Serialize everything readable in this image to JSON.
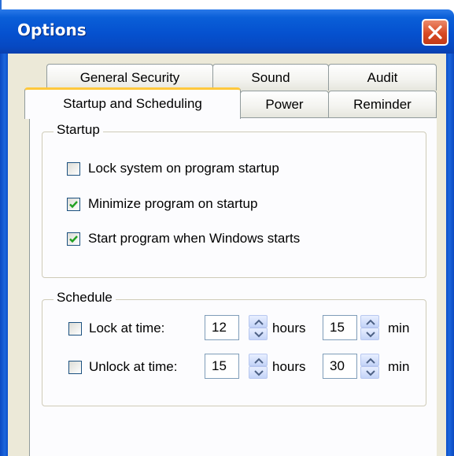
{
  "window": {
    "title": "Options"
  },
  "tabs": {
    "row1": [
      "General Security",
      "Sound",
      "Audit"
    ],
    "row2": [
      "Startup and Scheduling",
      "Power",
      "Reminder"
    ],
    "active": "Startup and Scheduling"
  },
  "startup": {
    "legend": "Startup",
    "options": [
      {
        "label": "Lock system on program startup",
        "checked": false
      },
      {
        "label": "Minimize program on startup",
        "checked": true
      },
      {
        "label": "Start program when Windows starts",
        "checked": true
      }
    ]
  },
  "schedule": {
    "legend": "Schedule",
    "lock": {
      "label": "Lock at time:",
      "checked": false,
      "hours": "12",
      "hours_unit": "hours",
      "minutes": "15",
      "minutes_unit": "min"
    },
    "unlock": {
      "label": "Unlock at time:",
      "checked": false,
      "hours": "15",
      "hours_unit": "hours",
      "minutes": "30",
      "minutes_unit": "min"
    }
  },
  "colors": {
    "title_bar": "#0551cf",
    "close_button": "#d84a24",
    "active_tab_highlight": "#ffc83c",
    "checkmark": "#21a121"
  },
  "icons": {
    "close": "close-x-icon",
    "check": "checkmark-icon",
    "spin_up": "arrow-up-icon",
    "spin_down": "arrow-down-icon"
  }
}
